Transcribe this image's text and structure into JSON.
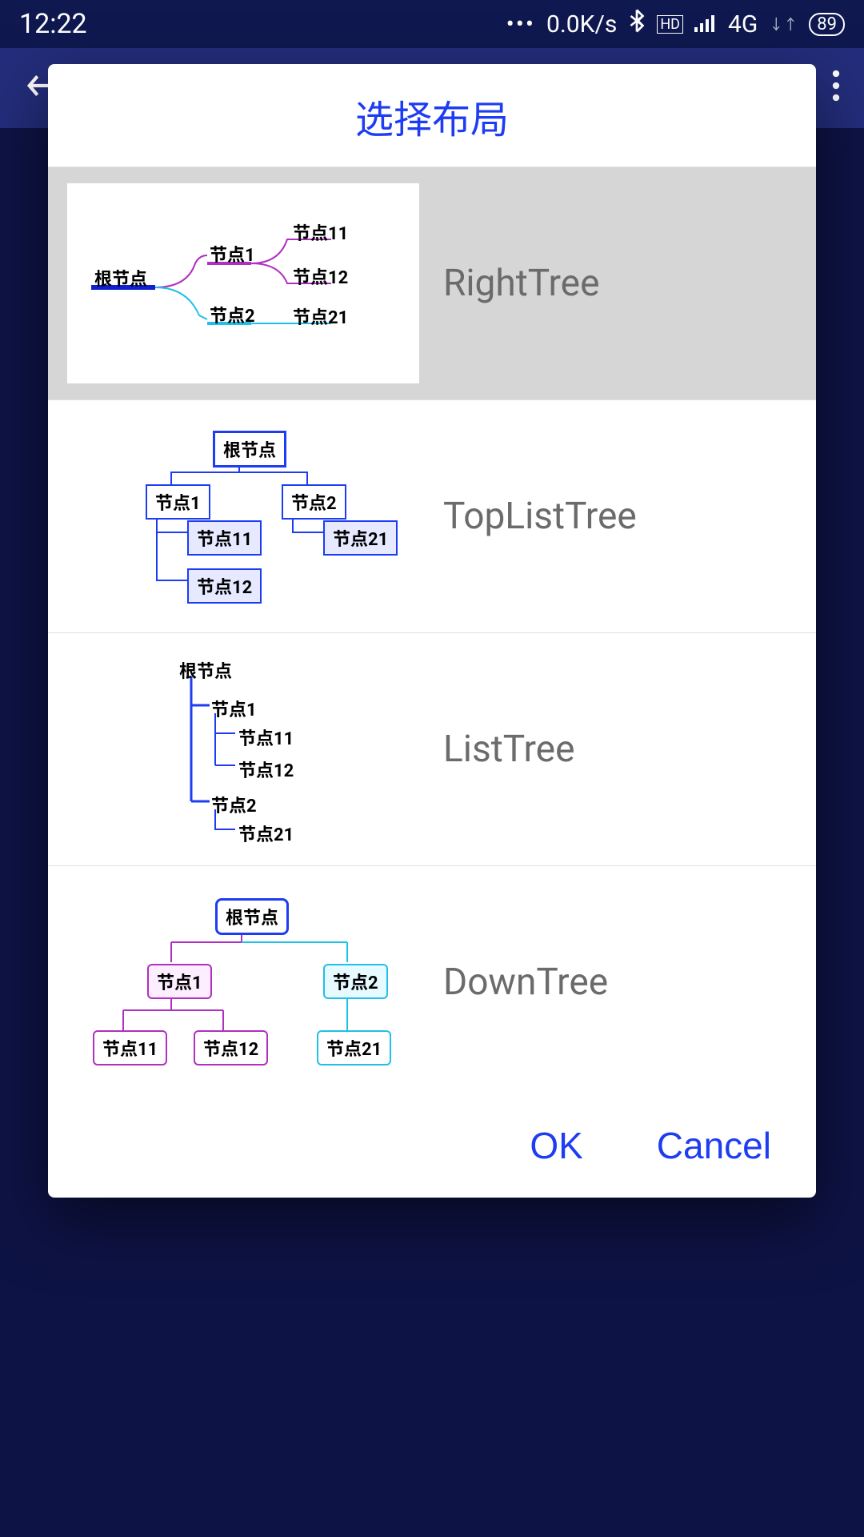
{
  "status": {
    "time": "12:22",
    "speed": "0.0K/s",
    "net": "4G",
    "hd": "HD",
    "battery": "89"
  },
  "dialog": {
    "title": "选择布局",
    "ok": "OK",
    "cancel": "Cancel"
  },
  "layouts": {
    "right": {
      "label": "RightTree"
    },
    "toplist": {
      "label": "TopListTree"
    },
    "list": {
      "label": "ListTree"
    },
    "down": {
      "label": "DownTree"
    }
  },
  "nodes": {
    "root": "根节点",
    "n1": "节点1",
    "n2": "节点2",
    "n11": "节点11",
    "n12": "节点12",
    "n21": "节点21"
  }
}
